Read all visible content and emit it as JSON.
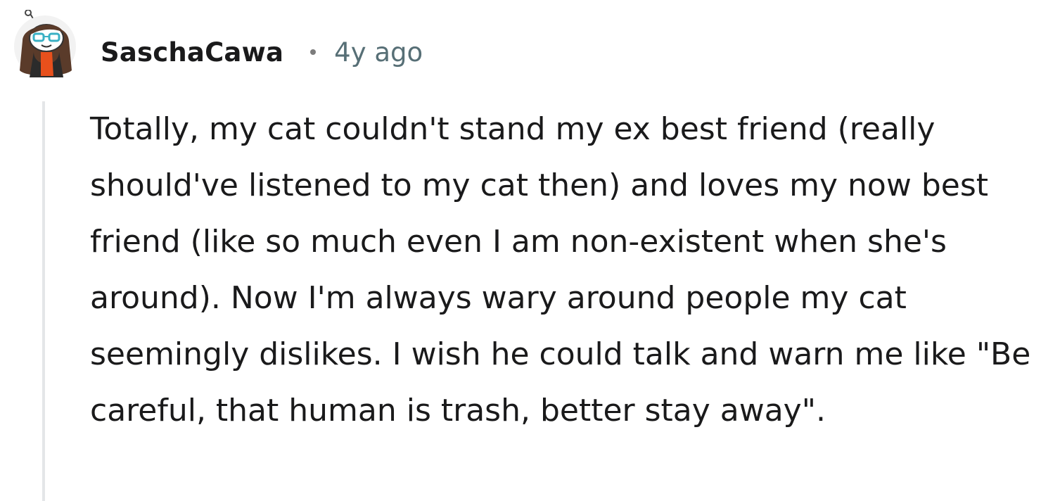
{
  "comment": {
    "author": "SaschaCawa",
    "timestamp": "4y ago",
    "avatar_icon": "snoo-avatar-icon",
    "body": "Totally, my cat couldn't stand my ex best friend (really should've listened to my cat then) and loves my now best friend (like so much even I am non-existent when she's around). Now I'm always wary around people my cat seemingly dislikes. I wish he could talk and warn me like \"Be careful, that human is trash, better stay away\"."
  },
  "colors": {
    "username": "#1a1a1b",
    "meta": "#576f76",
    "thread_line": "#e4e6e8",
    "avatar_hair": "#5a3b2a",
    "avatar_glasses": "#39b0c4",
    "avatar_scarf": "#e8501c"
  }
}
